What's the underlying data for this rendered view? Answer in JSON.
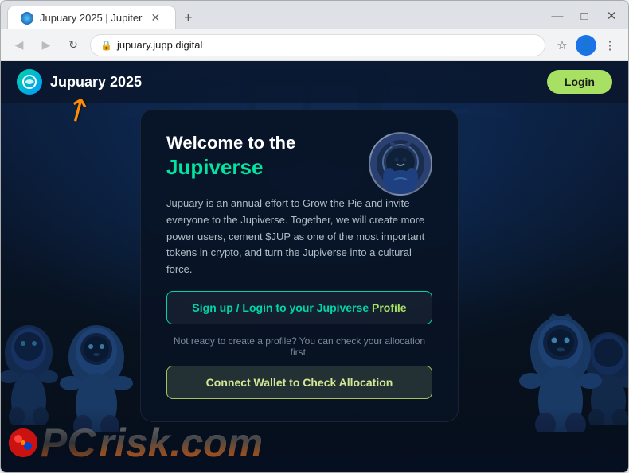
{
  "browser": {
    "tab_title": "Jupuary 2025 | Jupiter",
    "url": "jupuary.jupp.digital",
    "new_tab_label": "+",
    "back_icon": "◀",
    "forward_icon": "▶",
    "reload_icon": "↻",
    "star_icon": "☆",
    "menu_icon": "⋮",
    "profile_icon": "👤"
  },
  "site": {
    "logo_icon": "◎",
    "logo_text": "Jupuary 2025",
    "login_label": "Login"
  },
  "card": {
    "welcome_line1": "Welcome to the",
    "jupiverse_label": "Jupiverse",
    "description": "Jupuary is an annual effort to Grow the Pie and invite everyone to the Jupiverse. Together, we will create more power users, cement $JUP as one of the most important tokens in crypto, and turn the Jupiverse into a cultural force.",
    "cat_avatar_emoji": "🐱",
    "signup_btn_prefix": "Sign up / Login to your Jupiverse ",
    "signup_btn_highlight": "Profile",
    "not_ready_text": "Not ready to create a profile? You can check your allocation first.",
    "connect_btn_label": "Connect Wallet to Check Allocation"
  },
  "watermark": {
    "icon": "🔴",
    "text": "risk.com"
  },
  "colors": {
    "accent_green": "#00e5a0",
    "accent_lime": "#a8e063",
    "border_teal": "#00d4aa",
    "bg_dark": "#0a1628"
  }
}
